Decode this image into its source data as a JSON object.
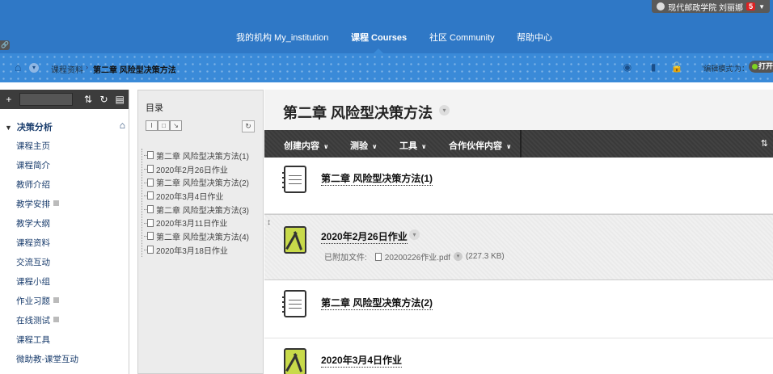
{
  "user": {
    "name": "现代邮政学院 刘丽娜",
    "notifications": "5"
  },
  "topnav": [
    {
      "label": "我的机构 My_institution"
    },
    {
      "label": "课程 Courses"
    },
    {
      "label": "社区 Community"
    },
    {
      "label": "帮助中心"
    }
  ],
  "breadcrumb": {
    "parent": "课程资料",
    "current": "第二章 风险型决策方法"
  },
  "edit_mode": {
    "label": "'编辑模式'为：",
    "state": "打开"
  },
  "course_menu": {
    "title": "决策分析",
    "items": [
      {
        "label": "课程主页"
      },
      {
        "label": "课程简介"
      },
      {
        "label": "教师介绍"
      },
      {
        "label": "教学安排"
      },
      {
        "label": "教学大纲"
      },
      {
        "label": "课程资料"
      },
      {
        "label": "交流互动"
      },
      {
        "label": "课程小组"
      },
      {
        "label": "作业习题"
      },
      {
        "label": "在线测试"
      },
      {
        "label": "课程工具"
      },
      {
        "label": "微助教-课堂互动"
      }
    ]
  },
  "toc": {
    "title": "目录",
    "items": [
      "第二章 风险型决策方法(1)",
      "2020年2月26日作业",
      "第二章 风险型决策方法(2)",
      "2020年3月4日作业",
      "第二章 风险型决策方法(3)",
      "2020年3月11日作业",
      "第二章 风险型决策方法(4)",
      "2020年3月18日作业"
    ]
  },
  "page": {
    "title": "第二章 风险型决策方法",
    "actions": [
      "创建内容",
      "测验",
      "工具",
      "合作伙伴内容"
    ]
  },
  "content_items": [
    {
      "title": "第二章 风险型决策方法(1)",
      "type": "document"
    },
    {
      "title": "2020年2月26日作业",
      "type": "assignment",
      "attachment_label": "已附加文件:",
      "attachment_file": "20200226作业.pdf",
      "attachment_size": "(227.3 KB)"
    },
    {
      "title": "第二章 风险型决策方法(2)",
      "type": "document"
    },
    {
      "title": "2020年3月4日作业",
      "type": "assignment"
    }
  ]
}
